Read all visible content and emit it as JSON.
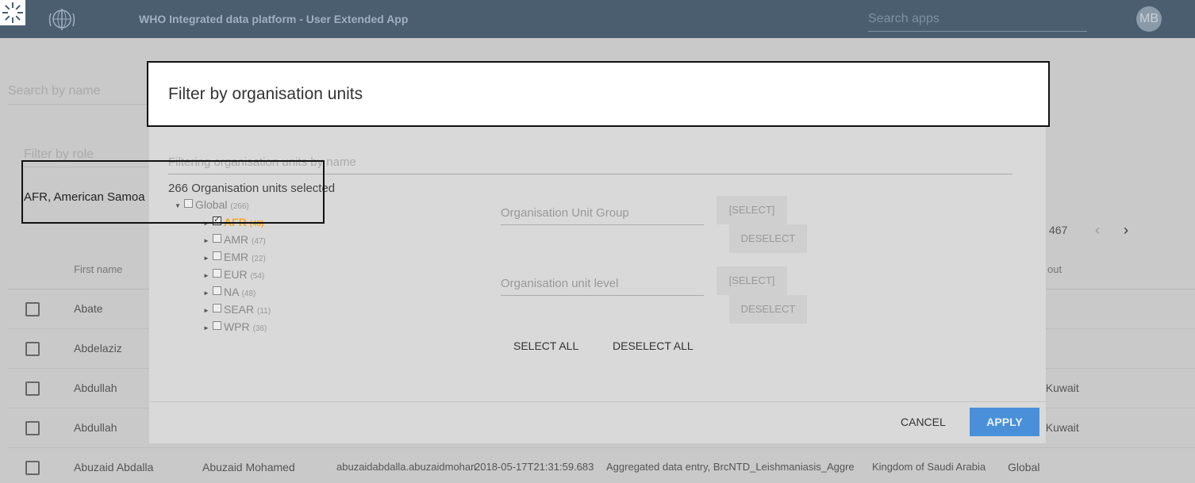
{
  "header": {
    "title": "WHO Integrated data platform - User Extended App",
    "search_placeholder": "Search apps",
    "avatar_initials": "MB",
    "brand_color": "#4a5e70"
  },
  "background": {
    "search_placeholder": "Search by name",
    "filter_role_placeholder": "Filter by role",
    "org_units_value": "AFR, American Samoa",
    "pager_total": "467",
    "col_first_name": "First name",
    "col_last_partial": "out",
    "rows": [
      {
        "first": "Abate",
        "surname": "",
        "username": "",
        "date": "",
        "roles": "",
        "orgunit": "",
        "group": "",
        "tail": ""
      },
      {
        "first": "Abdelaziz",
        "surname": "",
        "username": "",
        "date": "",
        "roles": "",
        "orgunit": "",
        "group": "",
        "tail": ""
      },
      {
        "first": "Abdullah",
        "surname": "",
        "username": "",
        "date": "",
        "roles": "",
        "orgunit": "",
        "group": "",
        "tail": "f Kuwait"
      },
      {
        "first": "Abdullah",
        "surname": "",
        "username": "",
        "date": "",
        "roles": "",
        "orgunit": "",
        "group": "",
        "tail": "f Kuwait"
      },
      {
        "first": "Abuzaid Abdalla",
        "surname": "Abuzaid Mohamed",
        "username": "abuzaidabdalla.abuzaidmohamed",
        "date": "2018-05-17T21:31:59.683",
        "roles": "Aggregated data entry, BrcNTD_Leishmaniasis_Aggre",
        "orgunit": "Kingdom of Saudi Arabia",
        "group": "Global",
        "tail": ""
      }
    ]
  },
  "dialog": {
    "title": "Filter by organisation units",
    "filter_placeholder": "Filtering organisation units by name",
    "selected_count_text": "266 Organisation units selected",
    "tree": [
      {
        "label": "Global",
        "count": "(266)",
        "checked": false,
        "expanded": true,
        "level": 0
      },
      {
        "label": "AFR",
        "count": "(48)",
        "checked": true,
        "expanded": false,
        "level": 1
      },
      {
        "label": "AMR",
        "count": "(47)",
        "checked": false,
        "expanded": false,
        "level": 1
      },
      {
        "label": "EMR",
        "count": "(22)",
        "checked": false,
        "expanded": false,
        "level": 1
      },
      {
        "label": "EUR",
        "count": "(54)",
        "checked": false,
        "expanded": false,
        "level": 1
      },
      {
        "label": "NA",
        "count": "(48)",
        "checked": false,
        "expanded": false,
        "level": 1
      },
      {
        "label": "SEAR",
        "count": "(11)",
        "checked": false,
        "expanded": false,
        "level": 1
      },
      {
        "label": "WPR",
        "count": "(36)",
        "checked": false,
        "expanded": false,
        "level": 1
      }
    ],
    "group_field_label": "Organisation Unit Group",
    "level_field_label": "Organisation unit level",
    "select_label": "[SELECT]",
    "deselect_label": "DESELECT",
    "select_all_label": "SELECT ALL",
    "deselect_all_label": "DESELECT ALL",
    "cancel_label": "CANCEL",
    "apply_label": "APPLY",
    "apply_color": "#4a90d9",
    "selected_color": "#f5a623"
  }
}
